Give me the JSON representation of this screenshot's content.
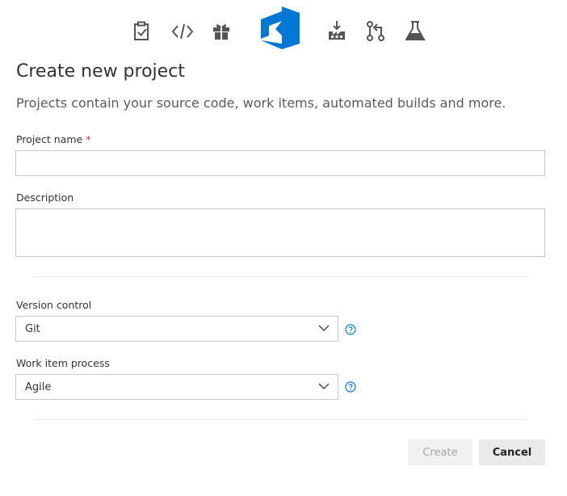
{
  "header": {
    "icons": [
      "boards-icon",
      "code-icon",
      "gift-icon",
      "visual-studio-logo",
      "build-icon",
      "pull-request-icon",
      "test-flask-icon"
    ]
  },
  "page": {
    "title": "Create new project",
    "subtitle": "Projects contain your source code, work items, automated builds and more."
  },
  "form": {
    "project_name": {
      "label": "Project name",
      "required_mark": "*",
      "value": ""
    },
    "description": {
      "label": "Description",
      "value": ""
    },
    "version_control": {
      "label": "Version control",
      "value": "Git"
    },
    "work_item_process": {
      "label": "Work item process",
      "value": "Agile"
    }
  },
  "actions": {
    "create_label": "Create",
    "cancel_label": "Cancel"
  },
  "colors": {
    "brand_blue": "#0078d4",
    "icon_gray": "#555555",
    "required": "#c4314b"
  }
}
